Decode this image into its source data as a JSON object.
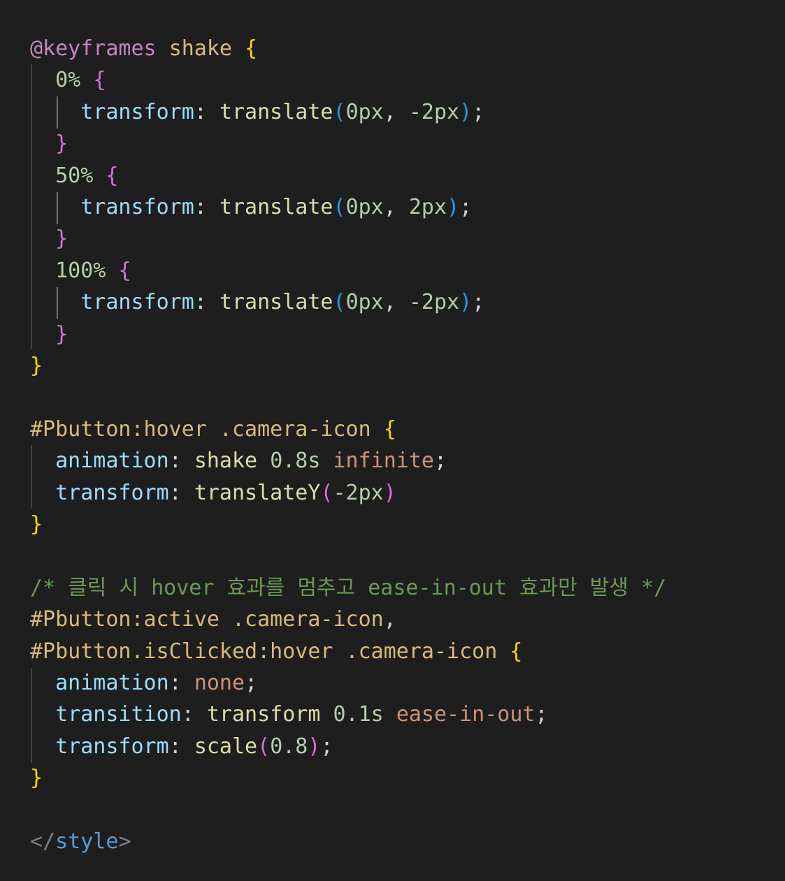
{
  "editor": {
    "background": "#1e1e1e",
    "lines": [
      [
        {
          "t": "@keyframes",
          "c": "t-at"
        },
        {
          "t": " ",
          "c": "t-def"
        },
        {
          "t": "shake",
          "c": "t-name"
        },
        {
          "t": " ",
          "c": "t-def"
        },
        {
          "t": "{",
          "c": "b1"
        }
      ],
      [
        {
          "t": "  ",
          "c": "t-def"
        },
        {
          "t": "0%",
          "c": "t-num"
        },
        {
          "t": " ",
          "c": "t-def"
        },
        {
          "t": "{",
          "c": "b2"
        }
      ],
      [
        {
          "t": "    ",
          "c": "t-def"
        },
        {
          "t": "transform",
          "c": "t-prop"
        },
        {
          "t": ": ",
          "c": "t-def"
        },
        {
          "t": "translate",
          "c": "t-fn"
        },
        {
          "t": "(",
          "c": "b3"
        },
        {
          "t": "0px",
          "c": "t-num"
        },
        {
          "t": ", ",
          "c": "t-def"
        },
        {
          "t": "-2px",
          "c": "t-num"
        },
        {
          "t": ")",
          "c": "b3"
        },
        {
          "t": ";",
          "c": "t-def"
        }
      ],
      [
        {
          "t": "  ",
          "c": "t-def"
        },
        {
          "t": "}",
          "c": "b2"
        }
      ],
      [
        {
          "t": "  ",
          "c": "t-def"
        },
        {
          "t": "50%",
          "c": "t-num"
        },
        {
          "t": " ",
          "c": "t-def"
        },
        {
          "t": "{",
          "c": "b2"
        }
      ],
      [
        {
          "t": "    ",
          "c": "t-def"
        },
        {
          "t": "transform",
          "c": "t-prop"
        },
        {
          "t": ": ",
          "c": "t-def"
        },
        {
          "t": "translate",
          "c": "t-fn"
        },
        {
          "t": "(",
          "c": "b3"
        },
        {
          "t": "0px",
          "c": "t-num"
        },
        {
          "t": ", ",
          "c": "t-def"
        },
        {
          "t": "2px",
          "c": "t-num"
        },
        {
          "t": ")",
          "c": "b3"
        },
        {
          "t": ";",
          "c": "t-def"
        }
      ],
      [
        {
          "t": "  ",
          "c": "t-def"
        },
        {
          "t": "}",
          "c": "b2"
        }
      ],
      [
        {
          "t": "  ",
          "c": "t-def"
        },
        {
          "t": "100%",
          "c": "t-num"
        },
        {
          "t": " ",
          "c": "t-def"
        },
        {
          "t": "{",
          "c": "b2"
        }
      ],
      [
        {
          "t": "    ",
          "c": "t-def"
        },
        {
          "t": "transform",
          "c": "t-prop"
        },
        {
          "t": ": ",
          "c": "t-def"
        },
        {
          "t": "translate",
          "c": "t-fn"
        },
        {
          "t": "(",
          "c": "b3"
        },
        {
          "t": "0px",
          "c": "t-num"
        },
        {
          "t": ", ",
          "c": "t-def"
        },
        {
          "t": "-2px",
          "c": "t-num"
        },
        {
          "t": ")",
          "c": "b3"
        },
        {
          "t": ";",
          "c": "t-def"
        }
      ],
      [
        {
          "t": "  ",
          "c": "t-def"
        },
        {
          "t": "}",
          "c": "b2"
        }
      ],
      [
        {
          "t": "}",
          "c": "b1"
        }
      ],
      [],
      [
        {
          "t": "#Pbutton:hover .camera-icon",
          "c": "t-sel"
        },
        {
          "t": " ",
          "c": "t-def"
        },
        {
          "t": "{",
          "c": "b1"
        }
      ],
      [
        {
          "t": "  ",
          "c": "t-def"
        },
        {
          "t": "animation",
          "c": "t-prop"
        },
        {
          "t": ": ",
          "c": "t-def"
        },
        {
          "t": "shake",
          "c": "t-fn"
        },
        {
          "t": " ",
          "c": "t-def"
        },
        {
          "t": "0.8s",
          "c": "t-num"
        },
        {
          "t": " ",
          "c": "t-def"
        },
        {
          "t": "infinite",
          "c": "t-kw"
        },
        {
          "t": ";",
          "c": "t-def"
        }
      ],
      [
        {
          "t": "  ",
          "c": "t-def"
        },
        {
          "t": "transform",
          "c": "t-prop"
        },
        {
          "t": ": ",
          "c": "t-def"
        },
        {
          "t": "translateY",
          "c": "t-fn"
        },
        {
          "t": "(",
          "c": "b2"
        },
        {
          "t": "-2px",
          "c": "t-num"
        },
        {
          "t": ")",
          "c": "b2"
        }
      ],
      [
        {
          "t": "}",
          "c": "b1"
        }
      ],
      [],
      [
        {
          "t": "/* 클릭 시 hover 효과를 멈추고 ease-in-out 효과만 발생 */",
          "c": "t-comment"
        }
      ],
      [
        {
          "t": "#Pbutton:active .camera-icon",
          "c": "t-sel"
        },
        {
          "t": ",",
          "c": "t-def"
        }
      ],
      [
        {
          "t": "#Pbutton.isClicked:hover .camera-icon",
          "c": "t-sel"
        },
        {
          "t": " ",
          "c": "t-def"
        },
        {
          "t": "{",
          "c": "b1"
        }
      ],
      [
        {
          "t": "  ",
          "c": "t-def"
        },
        {
          "t": "animation",
          "c": "t-prop"
        },
        {
          "t": ": ",
          "c": "t-def"
        },
        {
          "t": "none",
          "c": "t-kw"
        },
        {
          "t": ";",
          "c": "t-def"
        }
      ],
      [
        {
          "t": "  ",
          "c": "t-def"
        },
        {
          "t": "transition",
          "c": "t-prop"
        },
        {
          "t": ": ",
          "c": "t-def"
        },
        {
          "t": "transform",
          "c": "t-fn"
        },
        {
          "t": " ",
          "c": "t-def"
        },
        {
          "t": "0.1s",
          "c": "t-num"
        },
        {
          "t": " ",
          "c": "t-def"
        },
        {
          "t": "ease-in-out",
          "c": "t-kw"
        },
        {
          "t": ";",
          "c": "t-def"
        }
      ],
      [
        {
          "t": "  ",
          "c": "t-def"
        },
        {
          "t": "transform",
          "c": "t-prop"
        },
        {
          "t": ": ",
          "c": "t-def"
        },
        {
          "t": "scale",
          "c": "t-fn"
        },
        {
          "t": "(",
          "c": "b2"
        },
        {
          "t": "0.8",
          "c": "t-num"
        },
        {
          "t": ")",
          "c": "b2"
        },
        {
          "t": ";",
          "c": "t-def"
        }
      ],
      [
        {
          "t": "}",
          "c": "b1"
        }
      ],
      [],
      [
        {
          "t": "</",
          "c": "t-tag"
        },
        {
          "t": "style",
          "c": "t-tagname"
        },
        {
          "t": ">",
          "c": "t-tag"
        }
      ]
    ]
  }
}
